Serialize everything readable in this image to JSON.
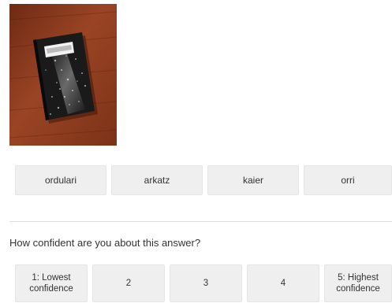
{
  "image": {
    "icon": "composition-notebook-photo"
  },
  "answers": [
    {
      "label": "ordulari"
    },
    {
      "label": "arkatz"
    },
    {
      "label": "kaier"
    },
    {
      "label": "orri"
    }
  ],
  "question": "How confident are you about this answer?",
  "confidence": [
    {
      "label": "1: Lowest\nconfidence"
    },
    {
      "label": "2"
    },
    {
      "label": "3"
    },
    {
      "label": "4"
    },
    {
      "label": "5: Highest\nconfidence"
    }
  ],
  "colors": {
    "button_bg": "#efefef",
    "text": "#333333",
    "divider": "#dddddd"
  }
}
